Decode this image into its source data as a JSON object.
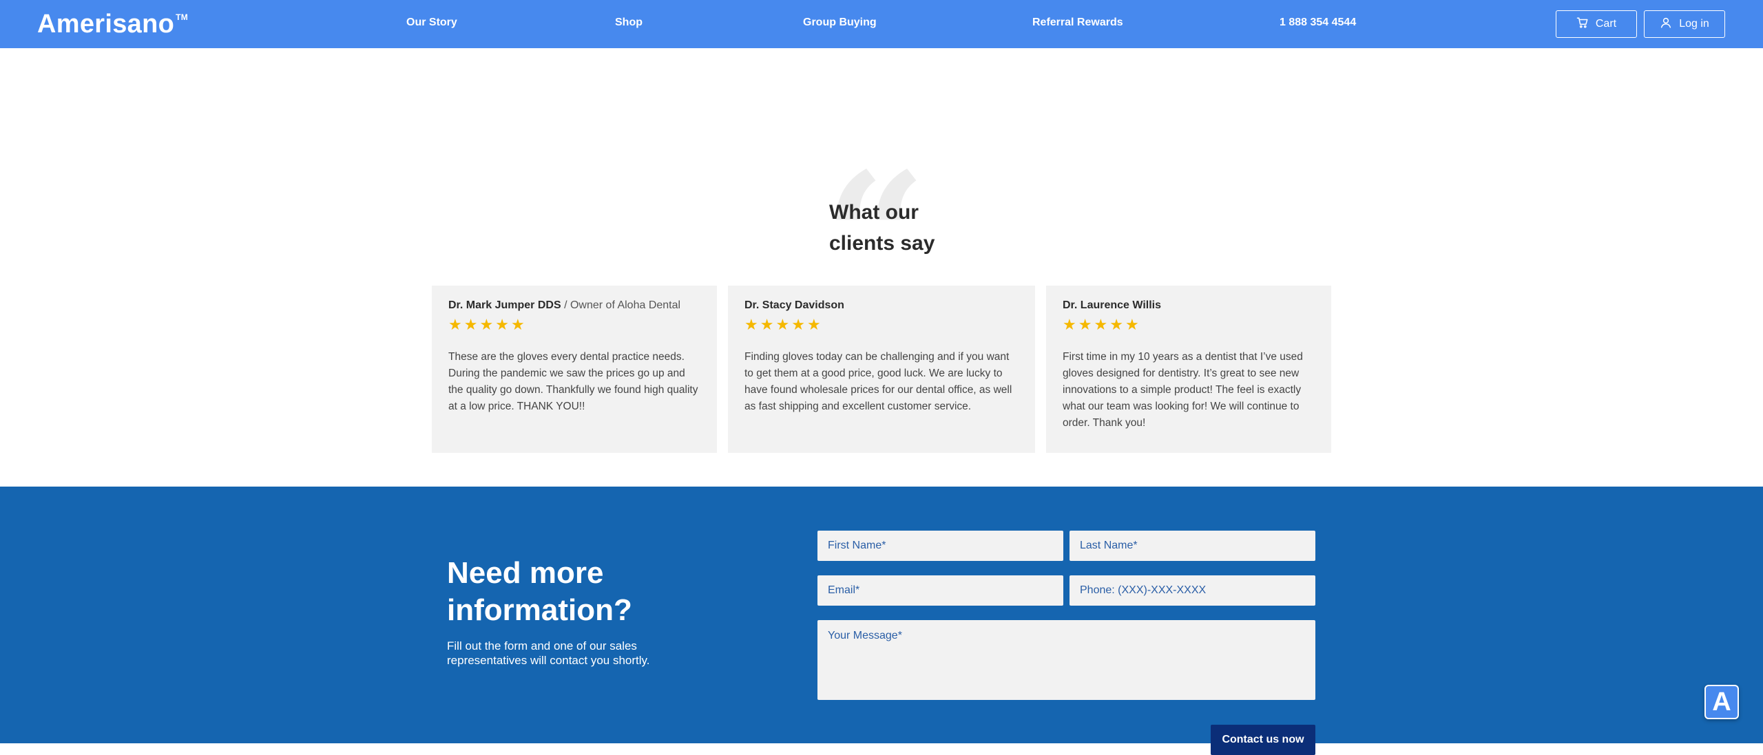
{
  "header": {
    "logo": "Amerisano",
    "logo_tm": "TM",
    "nav": [
      "Our Story",
      "Shop",
      "Group Buying",
      "Referral Rewards",
      "1 888 354 4544"
    ],
    "cart_label": "Cart",
    "login_label": "Log in",
    "bg_color": "#4789ee"
  },
  "testimonials": {
    "title_line1": "What our",
    "title_line2": "clients say",
    "quote_glyph": "“",
    "cards": [
      {
        "name": "Dr. Mark Jumper DDS",
        "separator": "/",
        "role": "Owner of Aloha Dental",
        "stars": 5,
        "text": "These are the gloves every dental practice needs. During the pandemic we saw the prices go up and the quality go down. Thankfully we found high quality at a low price. THANK YOU!!"
      },
      {
        "name": "Dr. Stacy Davidson",
        "stars": 5,
        "text": "Finding gloves today can be challenging and if you want to get them at a good price, good luck. We are lucky to have found wholesale prices for our dental office, as well as fast shipping and excellent customer service."
      },
      {
        "name": "Dr. Laurence Willis",
        "stars": 5,
        "text": "First time in my 10 years as a dentist that I’ve used gloves designed for dentistry. It’s great to see new innovations to a simple product! The feel is exactly what our team was looking for! We will continue to order. Thank you!"
      }
    ]
  },
  "contact": {
    "title": "Need more information?",
    "subtitle": "Fill out the form and one of our sales representatives will contact you shortly.",
    "first_name_placeholder": "First Name*",
    "last_name_placeholder": "Last Name*",
    "email_placeholder": "Email*",
    "phone_placeholder": "Phone: (XXX)-XXX-XXXX",
    "message_placeholder": "Your Message*",
    "submit_label": "Contact us now",
    "bg_color": "#1565b0"
  },
  "widget": {
    "label": "A"
  }
}
